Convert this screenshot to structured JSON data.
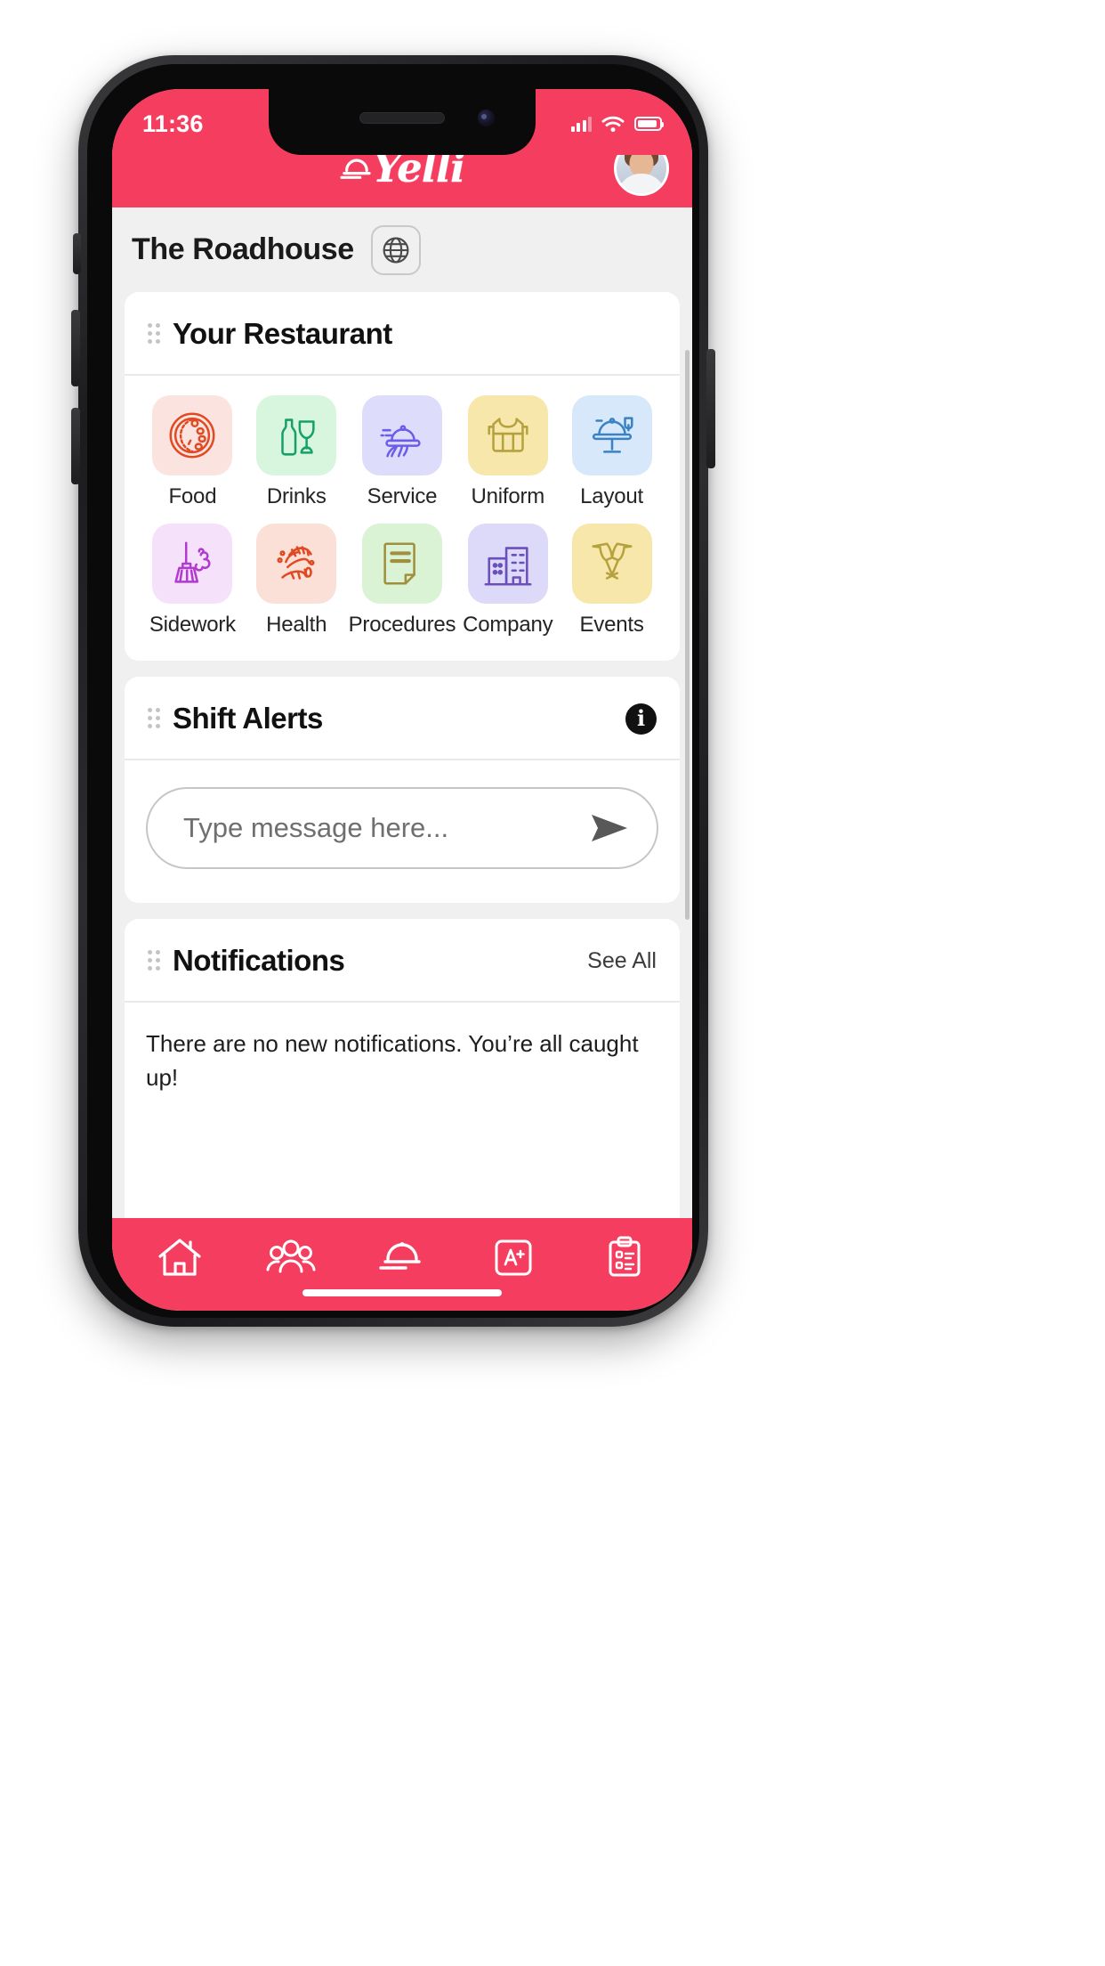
{
  "theme": {
    "brand": "#F53E5F",
    "page_bg": "#f0f0f0",
    "card_bg": "#ffffff"
  },
  "status_bar": {
    "time": "11:36",
    "signal_icon": "cellular-bars-icon",
    "wifi_icon": "wifi-icon",
    "battery_icon": "battery-icon"
  },
  "header": {
    "logo_text": "Yelli",
    "logo_icon": "cloche-icon",
    "avatar": "user-avatar"
  },
  "restaurant_bar": {
    "name": "The Roadhouse",
    "globe_button": "globe-icon"
  },
  "your_restaurant": {
    "title": "Your Restaurant",
    "drag_handle": "drag-handle-icon",
    "tiles": [
      {
        "label": "Food",
        "icon": "plate-food-icon",
        "bg": "#fbe4df",
        "stroke": "#e04a23"
      },
      {
        "label": "Drinks",
        "icon": "bottle-glass-icon",
        "bg": "#d8f5dd",
        "stroke": "#16a06a"
      },
      {
        "label": "Service",
        "icon": "cloche-hand-icon",
        "bg": "#dedcfb",
        "stroke": "#6c5ce7"
      },
      {
        "label": "Uniform",
        "icon": "apron-icon",
        "bg": "#f7e7ab",
        "stroke": "#b5a23f"
      },
      {
        "label": "Layout",
        "icon": "table-layout-icon",
        "bg": "#d7e8fb",
        "stroke": "#3b82c4"
      },
      {
        "label": "Sidework",
        "icon": "broom-icon",
        "bg": "#f6e1fb",
        "stroke": "#b13ad0"
      },
      {
        "label": "Health",
        "icon": "washing-hands-icon",
        "bg": "#fbe0d8",
        "stroke": "#e04a23"
      },
      {
        "label": "Procedures",
        "icon": "document-icon",
        "bg": "#d9f3d4",
        "stroke": "#a08f3c"
      },
      {
        "label": "Company",
        "icon": "office-building-icon",
        "bg": "#ddd9f8",
        "stroke": "#6b4fbb"
      },
      {
        "label": "Events",
        "icon": "champagne-toast-icon",
        "bg": "#f7e7ab",
        "stroke": "#b5a23f"
      }
    ]
  },
  "shift_alerts": {
    "title": "Shift Alerts",
    "drag_handle": "drag-handle-icon",
    "info_icon": "info-icon",
    "info_label": "i",
    "message_input": {
      "value": "",
      "placeholder": "Type message here..."
    },
    "send_icon": "send-arrow-icon"
  },
  "notifications": {
    "title": "Notifications",
    "drag_handle": "drag-handle-icon",
    "see_all_label": "See All",
    "empty_text": "There are no new notifications. You’re all caught up!"
  },
  "tab_bar": {
    "items": [
      {
        "name": "home",
        "icon": "home-icon"
      },
      {
        "name": "team",
        "icon": "people-group-icon"
      },
      {
        "name": "service",
        "icon": "cloche-icon"
      },
      {
        "name": "training",
        "icon": "a-plus-icon",
        "label": "A"
      },
      {
        "name": "checklist",
        "icon": "clipboard-icon"
      }
    ]
  }
}
